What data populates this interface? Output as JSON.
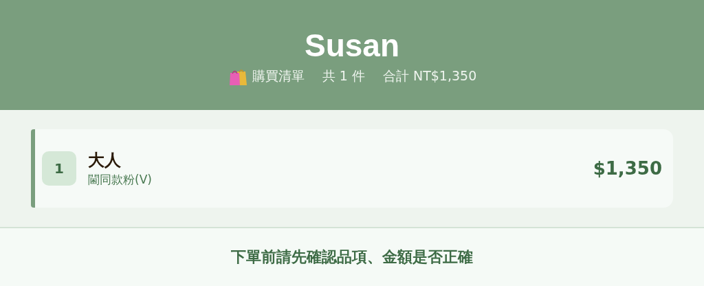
{
  "header": {
    "title": "Susan",
    "list_label": "購買清單",
    "count": "共 1 件",
    "total": "合計 NT$1,350"
  },
  "items": [
    {
      "index": "1",
      "name": "大人",
      "detail": "閫同款粉(V)",
      "price": "$1,350"
    }
  ],
  "footer": {
    "notice": "下單前請先確認品項、金額是否正確"
  }
}
